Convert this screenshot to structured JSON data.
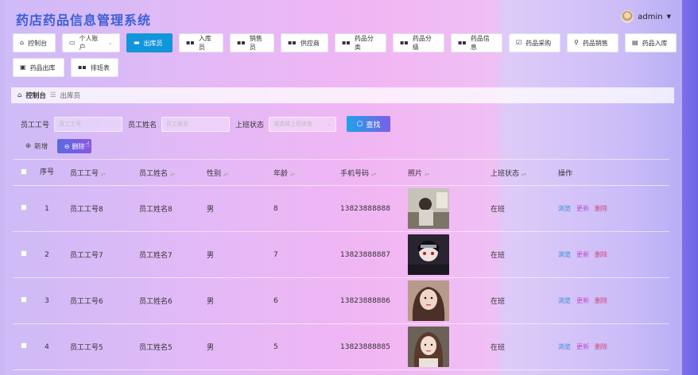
{
  "header": {
    "title": "药店药品信息管理系统",
    "user": "admin"
  },
  "nav": [
    {
      "label": "控制台",
      "icon": "home-icon"
    },
    {
      "label": "个人账户",
      "icon": "user-card-icon",
      "dropdown": true
    },
    {
      "label": "出库员",
      "icon": "monitor-icon",
      "active": true
    },
    {
      "label": "入库员",
      "icon": "grid-icon"
    },
    {
      "label": "销售员",
      "icon": "grid-icon"
    },
    {
      "label": "供应商",
      "icon": "grid-icon"
    },
    {
      "label": "药品分类",
      "icon": "grid-icon"
    },
    {
      "label": "药品分级",
      "icon": "grid-icon"
    },
    {
      "label": "药品信息",
      "icon": "grid-icon"
    },
    {
      "label": "药品采购",
      "icon": "checkbox-icon"
    },
    {
      "label": "药品销售",
      "icon": "person-icon"
    },
    {
      "label": "药品入库",
      "icon": "box-icon"
    },
    {
      "label": "药品出库",
      "icon": "export-icon"
    },
    {
      "label": "排班表",
      "icon": "grid-icon"
    }
  ],
  "breadcrumb": {
    "home": "控制台",
    "separator": "☰",
    "current": "出库员"
  },
  "search": {
    "id_label": "员工工号",
    "id_placeholder": "员工工号",
    "name_label": "员工姓名",
    "name_placeholder": "员工姓名",
    "status_label": "上班状态",
    "status_placeholder": "请选择上班状态",
    "find_label": "查找"
  },
  "actions": {
    "add_label": "新增",
    "delete_label": "删除"
  },
  "table": {
    "headers": {
      "no": "序号",
      "id": "员工工号",
      "name": "员工姓名",
      "sex": "性别",
      "age": "年龄",
      "phone": "手机号码",
      "photo": "照片",
      "status": "上班状态",
      "ops": "操作"
    },
    "ops": {
      "view": "浏览",
      "edit": "更新",
      "delete": "删除"
    },
    "rows": [
      {
        "no": "1",
        "id": "员工工号8",
        "name": "员工姓名8",
        "sex": "男",
        "age": "8",
        "phone": "13823888888",
        "status": "在班"
      },
      {
        "no": "2",
        "id": "员工工号7",
        "name": "员工姓名7",
        "sex": "男",
        "age": "7",
        "phone": "13823888887",
        "status": "在班"
      },
      {
        "no": "3",
        "id": "员工工号6",
        "name": "员工姓名6",
        "sex": "男",
        "age": "6",
        "phone": "13823888886",
        "status": "在班"
      },
      {
        "no": "4",
        "id": "员工工号5",
        "name": "员工姓名5",
        "sex": "男",
        "age": "5",
        "phone": "13823888885",
        "status": "在班"
      }
    ]
  },
  "colors": {
    "title": "#3d5fd6",
    "active_nav": "#1296db",
    "view": "#2b8ad6",
    "edit": "#c14ad8",
    "delete": "#d0457e"
  }
}
